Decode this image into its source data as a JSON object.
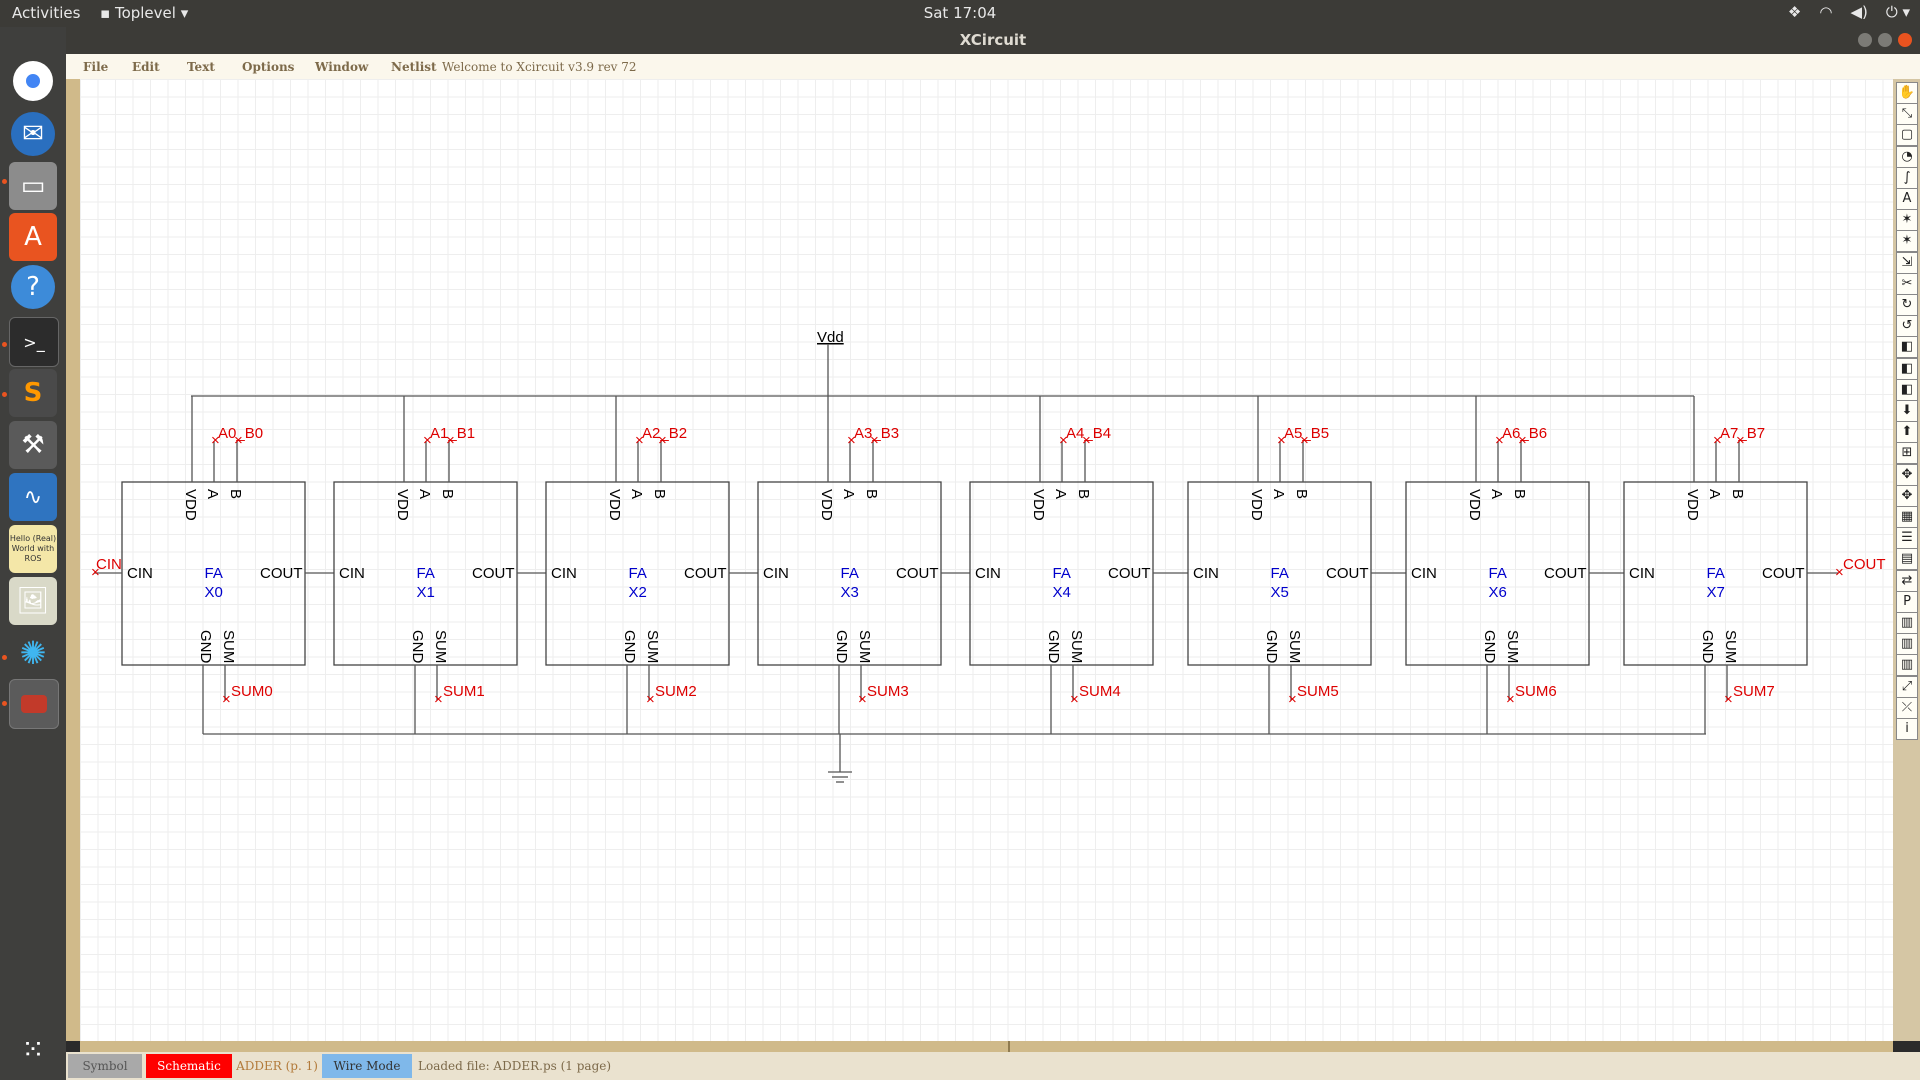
{
  "topbar": {
    "activities": "Activities",
    "app_menu": "Toplevel",
    "clock": "Sat 17:04"
  },
  "dock": {
    "items": [
      "chrome-icon",
      "thunderbird-icon",
      "files-icon",
      "software-center-icon",
      "help-icon",
      "terminal-icon",
      "sublime-icon",
      "tools-icon",
      "scope-icon",
      "ros-tutorial-icon",
      "image-viewer-icon",
      "settings-icon",
      "xcircuit-icon"
    ],
    "ros_label": "Hello (Real) World with ROS",
    "apps_grid": "show-applications-icon"
  },
  "window": {
    "title": "XCircuit"
  },
  "menubar": {
    "items": [
      "File",
      "Edit",
      "Text",
      "Options",
      "Window",
      "Netlist"
    ],
    "welcome": "Welcome to Xcircuit v3.9 rev 72"
  },
  "schematic": {
    "vdd_label": "Vdd",
    "cin_label": "CIN",
    "cout_label": "COUT",
    "blocks": [
      {
        "type": "FA",
        "name": "X0",
        "inputs": "A0_B0",
        "sum": "SUM0"
      },
      {
        "type": "FA",
        "name": "X1",
        "inputs": "A1_B1",
        "sum": "SUM1"
      },
      {
        "type": "FA",
        "name": "X2",
        "inputs": "A2_B2",
        "sum": "SUM2"
      },
      {
        "type": "FA",
        "name": "X3",
        "inputs": "A3_B3",
        "sum": "SUM3"
      },
      {
        "type": "FA",
        "name": "X4",
        "inputs": "A4_B4",
        "sum": "SUM4"
      },
      {
        "type": "FA",
        "name": "X5",
        "inputs": "A5_B5",
        "sum": "SUM5"
      },
      {
        "type": "FA",
        "name": "X6",
        "inputs": "A6_B6",
        "sum": "SUM6"
      },
      {
        "type": "FA",
        "name": "X7",
        "inputs": "A7_B7",
        "sum": "SUM7"
      }
    ],
    "pins": {
      "vdd": "VDD",
      "a": "A",
      "b": "B",
      "cin": "CIN",
      "cout": "COUT",
      "gnd": "GND",
      "sum": "SUM"
    }
  },
  "statusbar": {
    "symbol": "Symbol",
    "schematic": "Schematic",
    "page": "ADDER (p. 1)",
    "mode": "Wire Mode",
    "message": "Loaded file: ADDER.ps (1 page)"
  },
  "colors": {
    "schematic_button": "#ff0000",
    "mode_button": "#7fb8ea",
    "accent": "#e95420"
  }
}
